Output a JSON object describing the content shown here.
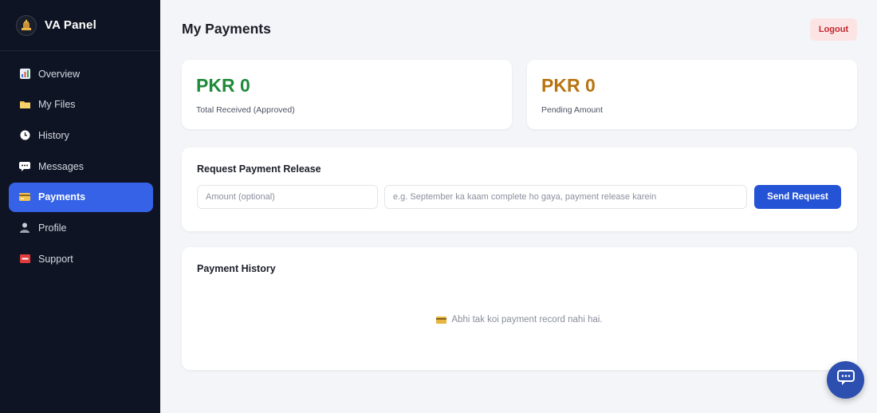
{
  "sidebar": {
    "brand": "VA Panel",
    "items": [
      {
        "label": "Overview",
        "icon": "bar-chart-icon"
      },
      {
        "label": "My Files",
        "icon": "folder-icon"
      },
      {
        "label": "History",
        "icon": "clock-icon"
      },
      {
        "label": "Messages",
        "icon": "chat-bubble-icon"
      },
      {
        "label": "Payments",
        "icon": "credit-card-icon",
        "active": true
      },
      {
        "label": "Profile",
        "icon": "user-icon"
      },
      {
        "label": "Support",
        "icon": "sos-icon"
      }
    ]
  },
  "header": {
    "title": "My Payments",
    "logout_label": "Logout"
  },
  "stats": {
    "received": {
      "value": "PKR 0",
      "label": "Total Received (Approved)",
      "color": "#1f8a3a"
    },
    "pending": {
      "value": "PKR 0",
      "label": "Pending Amount",
      "color": "#b8730f"
    }
  },
  "request": {
    "title": "Request Payment Release",
    "amount_placeholder": "Amount (optional)",
    "note_placeholder": "e.g. September ka kaam complete ho gaya, payment release karein",
    "send_label": "Send Request"
  },
  "history": {
    "title": "Payment History",
    "empty_text": "Abhi tak koi payment record nahi hai."
  },
  "colors": {
    "sidebar_bg": "#0f1424",
    "accent": "#3562e6",
    "primary_button": "#2453d6",
    "logout_bg": "#fde4e4",
    "logout_text": "#c0282d"
  }
}
